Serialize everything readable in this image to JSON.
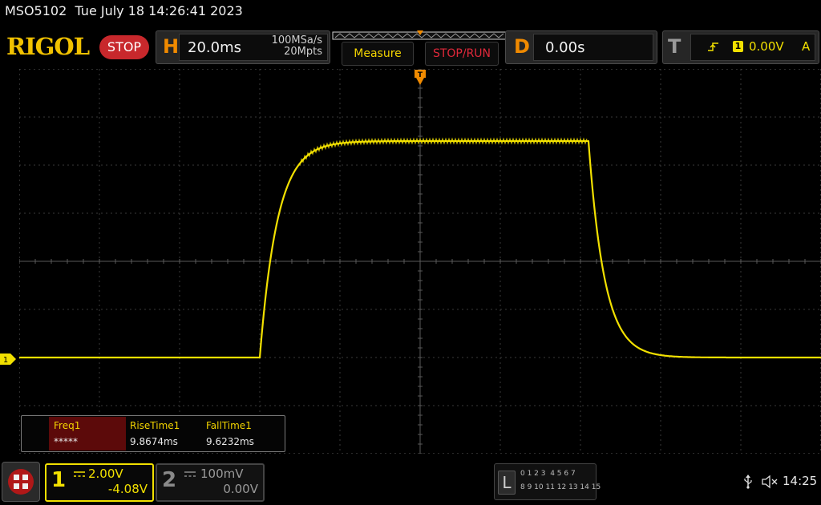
{
  "header": {
    "model": "MSO5102",
    "datetime": "Tue July 18 14:26:41 2023",
    "brand": "RIGOL",
    "run_state": "STOP"
  },
  "horizontal": {
    "letter": "H",
    "timebase": "20.0ms",
    "sample_rate": "100MSa/s",
    "mem_depth": "20Mpts"
  },
  "toolbar": {
    "measure_label": "Measure",
    "stoprun_label": "STOP/RUN"
  },
  "delay": {
    "letter": "D",
    "value": "0.00s"
  },
  "trigger": {
    "letter": "T",
    "source": "1",
    "level": "0.00V",
    "mode": "A"
  },
  "measurements": {
    "headers": [
      "Freq1",
      "RiseTime1",
      "FallTime1"
    ],
    "values": [
      "*****",
      "9.8674ms",
      "9.6232ms"
    ]
  },
  "ch1": {
    "number": "1",
    "scale": "2.00V",
    "offset": "-4.08V",
    "marker": "1",
    "color": "#f2e000"
  },
  "ch2": {
    "number": "2",
    "scale": "100mV",
    "offset": "0.00V"
  },
  "logic": {
    "letter": "L",
    "row1": "0 1 2 3  4 5 6 7",
    "row2": "8 9 10 11 12 13 14 15"
  },
  "status": {
    "time": "14:25"
  },
  "waveform": {
    "baseline_div": -2.0,
    "high_div": 2.5,
    "rise_start_div": -2.0,
    "fall_start_div": 2.1,
    "time_per_div_ms": 20,
    "volts_per_div": 2.0
  }
}
